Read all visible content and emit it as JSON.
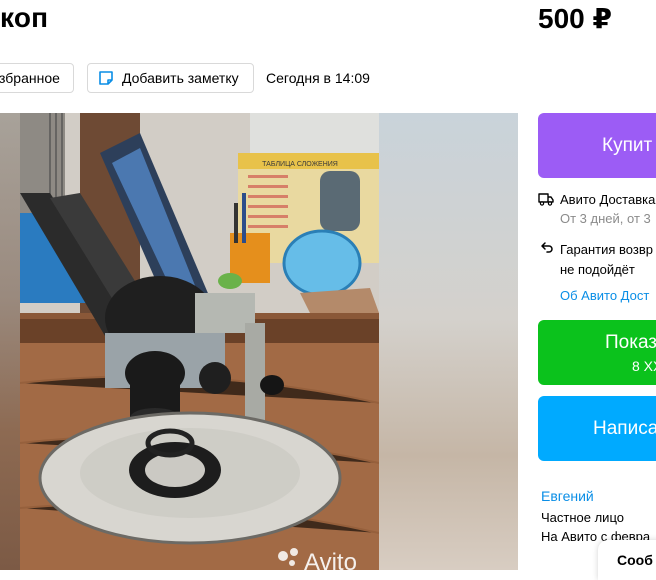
{
  "header": {
    "title": "коп",
    "price": "500 ₽"
  },
  "actions": {
    "favorite_label": "збранное",
    "note_label": "Добавить заметку",
    "date": "Сегодня в 14:09"
  },
  "gallery": {
    "watermark": "Avito",
    "poster_title": "ТАБЛИЦА СЛОЖЕНИЯ"
  },
  "sidebar": {
    "buy_label": "Купит",
    "delivery_title": "Авито Доставка",
    "delivery_sub": "От 3 дней, от 3",
    "guarantee_text": "Гарантия возвр не подойдёт",
    "about_link": "Об Авито Дост",
    "phone_label": "Показ",
    "phone_sub": "8 ХХ",
    "write_label": "Написа"
  },
  "seller": {
    "name": "Евгений",
    "type": "Частное лицо",
    "since": "На Авито с февра"
  },
  "chat": {
    "label": "Сооб"
  },
  "colors": {
    "buy": "#9c5cf5",
    "phone": "#0bc21c",
    "write": "#00aaff",
    "link": "#0a8ee6"
  }
}
